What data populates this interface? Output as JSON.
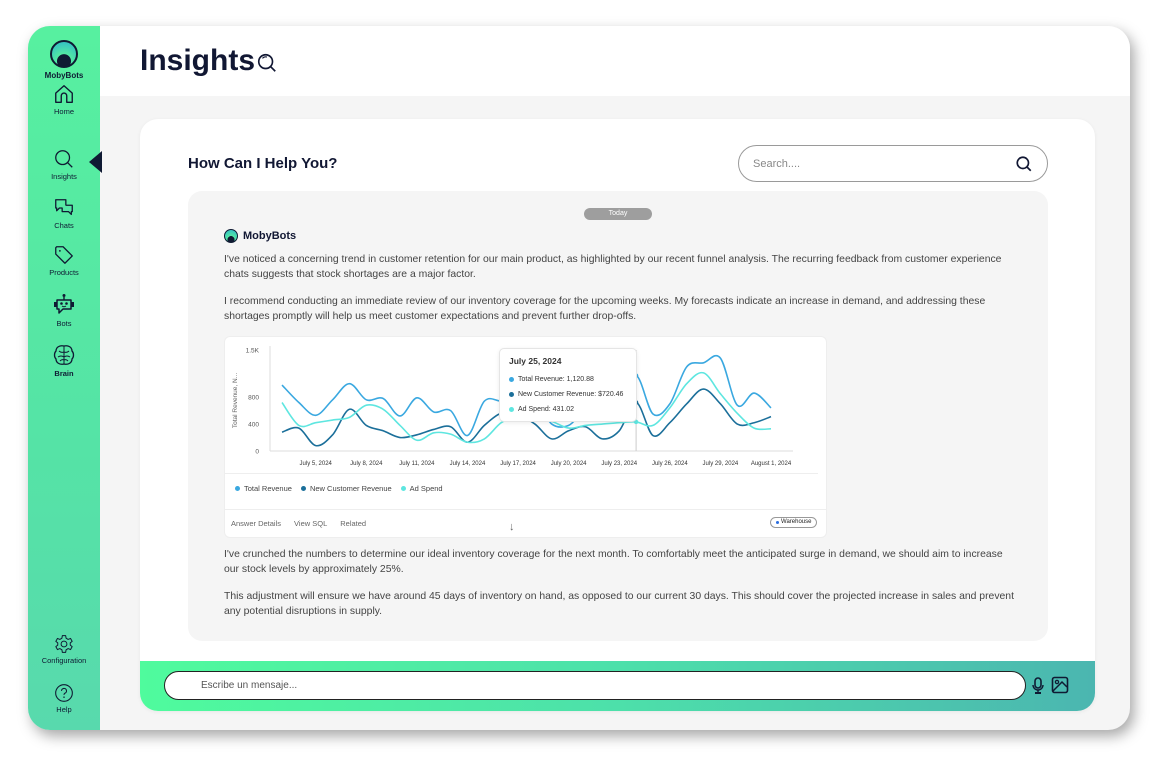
{
  "app": {
    "name": "MobyBots"
  },
  "sidebar": {
    "items": [
      {
        "id": "home",
        "label": "Home",
        "icon": "home-icon"
      },
      {
        "id": "insights",
        "label": "Insights",
        "icon": "search-icon",
        "active": true
      },
      {
        "id": "chats",
        "label": "Chats",
        "icon": "chat-bubbles-icon"
      },
      {
        "id": "products",
        "label": "Products",
        "icon": "tag-icon"
      },
      {
        "id": "bots",
        "label": "Bots",
        "icon": "robot-icon"
      },
      {
        "id": "brain",
        "label": "Brain",
        "icon": "brain-icon"
      }
    ],
    "bottom_items": [
      {
        "id": "configuration",
        "label": "Configuration",
        "icon": "gear-icon"
      },
      {
        "id": "help",
        "label": "Help",
        "icon": "help-icon"
      }
    ]
  },
  "header": {
    "title": "Insights",
    "title_icon": "search-icon"
  },
  "main": {
    "heading": "How Can I Help You?",
    "search": {
      "placeholder": "Search....",
      "value": ""
    }
  },
  "conversation": {
    "day_label": "Today",
    "sender": "MobyBots",
    "messages": [
      "I've noticed a concerning trend in customer retention for our main product, as highlighted by our recent funnel analysis. The recurring feedback from customer experience chats suggests that stock shortages are a major factor.",
      "I recommend conducting an immediate review of our inventory coverage for the upcoming weeks. My forecasts indicate an increase in demand, and addressing these shortages promptly will help us meet customer expectations and prevent further drop-offs.",
      "I've crunched the numbers to determine our ideal inventory coverage for the next month. To comfortably meet the anticipated surge in demand, we should aim to increase our stock levels by approximately 25%.",
      "This adjustment will ensure we have around 45 days of inventory on hand, as opposed to our current 30 days. This should cover the projected increase in sales and prevent any potential disruptions in supply."
    ],
    "chart_footer": {
      "links": [
        "Answer Details",
        "View SQL",
        "Related"
      ],
      "badge": "Warehouse"
    }
  },
  "chart_data": {
    "type": "line",
    "title": "",
    "xlabel": "",
    "ylabel": "Total Revenue, N...",
    "ylim": [
      0,
      1500
    ],
    "y_ticks": [
      "0",
      "400",
      "800",
      "1.5K"
    ],
    "y_tick_values": [
      0,
      400,
      800,
      1500
    ],
    "x_ticks": [
      "July 5, 2024",
      "July 8, 2024",
      "July 11, 2024",
      "July 14, 2024",
      "July 17, 2024",
      "July 20, 2024",
      "July 23, 2024",
      "July 26, 2024",
      "July 29, 2024",
      "August 1, 2024"
    ],
    "x": [
      "Jul 3",
      "Jul 4",
      "Jul 5",
      "Jul 6",
      "Jul 7",
      "Jul 8",
      "Jul 9",
      "Jul 10",
      "Jul 11",
      "Jul 12",
      "Jul 13",
      "Jul 14",
      "Jul 15",
      "Jul 16",
      "Jul 17",
      "Jul 18",
      "Jul 19",
      "Jul 20",
      "Jul 21",
      "Jul 22",
      "Jul 23",
      "Jul 24",
      "Jul 25",
      "Jul 26",
      "Jul 27",
      "Jul 28",
      "Jul 29",
      "Jul 30",
      "Jul 31",
      "Aug 1"
    ],
    "series": [
      {
        "name": "Total Revenue",
        "color": "#3aa8e0",
        "values": [
          980,
          720,
          530,
          760,
          1000,
          760,
          780,
          520,
          790,
          580,
          600,
          230,
          740,
          740,
          740,
          760,
          400,
          380,
          600,
          520,
          700,
          1120.88,
          550,
          700,
          1250,
          1310,
          1380,
          680,
          860,
          640
        ]
      },
      {
        "name": "New Customer Revenue",
        "color": "#1b6f9a",
        "values": [
          280,
          340,
          80,
          240,
          620,
          380,
          300,
          200,
          240,
          320,
          360,
          130,
          380,
          560,
          540,
          400,
          180,
          300,
          360,
          180,
          300,
          720.46,
          230,
          420,
          700,
          920,
          700,
          400,
          420,
          510
        ]
      },
      {
        "name": "Ad Spend",
        "color": "#5ee6e0",
        "values": [
          720,
          380,
          420,
          460,
          500,
          680,
          620,
          380,
          160,
          270,
          250,
          130,
          180,
          420,
          520,
          500,
          440,
          340,
          380,
          400,
          420,
          431.02,
          380,
          640,
          1000,
          1160,
          850,
          560,
          340,
          330
        ]
      }
    ],
    "legend": [
      "Total Revenue",
      "New Customer Revenue",
      "Ad Spend"
    ],
    "legend_position": "bottom-left",
    "grid": false,
    "tooltip": {
      "date": "July 25, 2024",
      "rows": [
        {
          "label": "Total Revenue: 1,120.88",
          "color": "#3aa8e0"
        },
        {
          "label": "New Customer Revenue: $720.46",
          "color": "#1b6f9a"
        },
        {
          "label": "Ad Spend: 431.02",
          "color": "#5ee6e0"
        }
      ]
    },
    "highlight_index": 21
  },
  "composer": {
    "placeholder": "Escribe un mensaje...",
    "value": ""
  }
}
